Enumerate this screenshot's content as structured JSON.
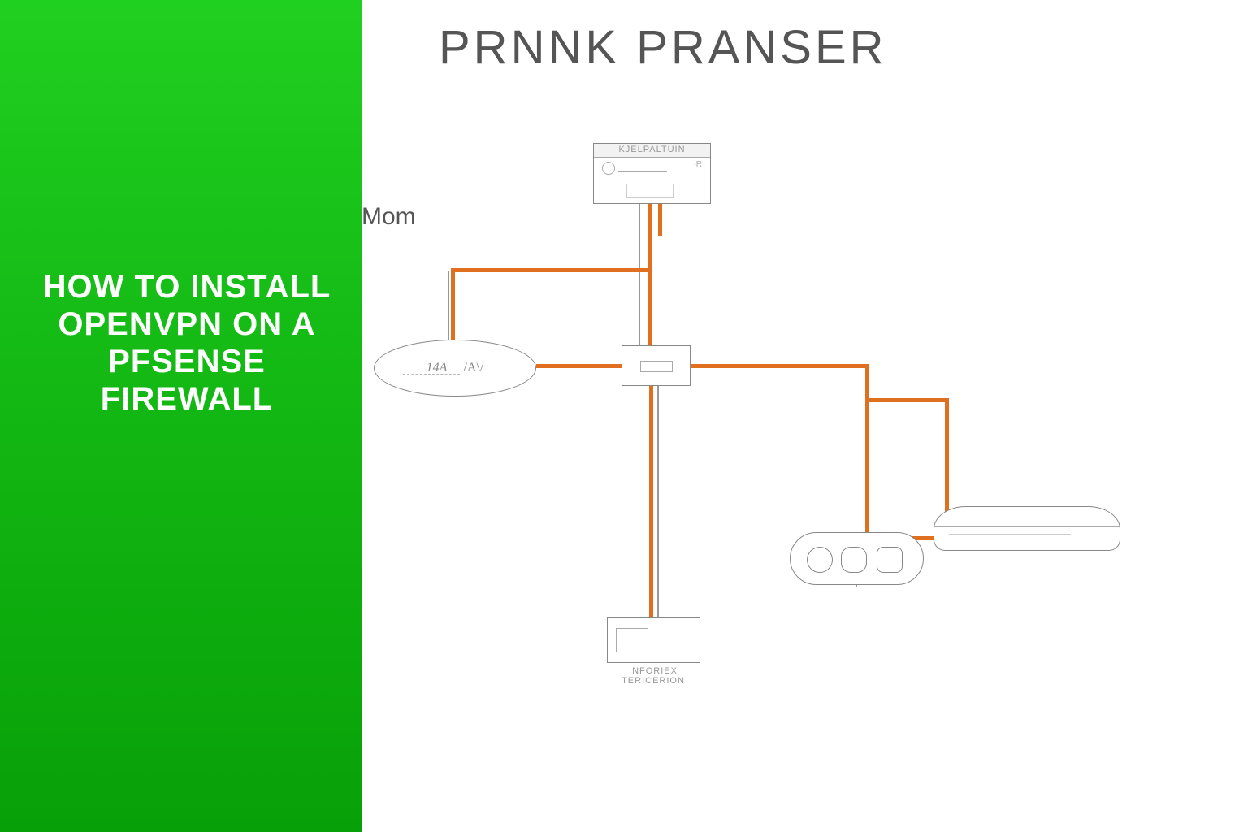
{
  "sidebar": {
    "title": "HOW TO INSTALL OPENVPN ON A PFSENSE FIREWALL"
  },
  "diagram": {
    "title": "PRNNK PRANSER",
    "small_label": "Mom",
    "nodes": {
      "top_device_header": "KJELPALTUIN",
      "oval_left": "14A",
      "oval_right": "/A\\/",
      "bottom_device_caption": "INFORIEX TERICERION"
    },
    "colors": {
      "accent_green_top": "#20d020",
      "accent_green_bottom": "#08a008",
      "wire_orange": "#e07020",
      "line_gray": "#999999",
      "text_gray": "#555555"
    }
  }
}
